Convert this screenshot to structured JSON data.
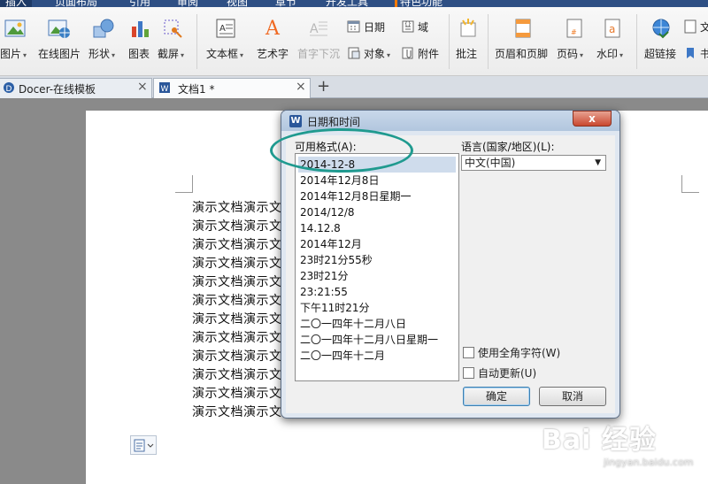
{
  "menu": {
    "tabs": [
      "插入",
      "页面布局",
      "引用",
      "审阅",
      "视图",
      "章节",
      "开发工具",
      "特色功能"
    ],
    "active": "插入"
  },
  "ribbon": {
    "items": {
      "picture": "图片",
      "online_picture": "在线图片",
      "shape": "形状",
      "chart": "图表",
      "screenshot": "截屏",
      "textbox": "文本框",
      "wordart": "艺术字",
      "dropcap": "首字下沉",
      "date": "日期",
      "object": "对象",
      "field": "域",
      "attachment": "附件",
      "comment": "批注",
      "header_footer": "页眉和页脚",
      "page_number": "页码",
      "watermark": "水印",
      "hyperlink": "超链接",
      "crossref_partial": "书",
      "text_partial": "文"
    }
  },
  "doc_tabs": [
    {
      "label": "Docer-在线模板",
      "close": "×"
    },
    {
      "label": "文档1 *",
      "close": "×"
    }
  ],
  "tab_add": "+",
  "document": {
    "line_text": "演示文档演示文档",
    "line_count": 12
  },
  "dialog": {
    "title": "日期和时间",
    "close": "x",
    "formats_label": "可用格式(A):",
    "formats": [
      "2014-12-8",
      "2014年12月8日",
      "2014年12月8日星期一",
      "2014/12/8",
      "14.12.8",
      "2014年12月",
      "23时21分55秒",
      "23时21分",
      "23:21:55",
      "下午11时21分",
      "二〇一四年十二月八日",
      "二〇一四年十二月八日星期一",
      "二〇一四年十二月"
    ],
    "selected_index": 0,
    "language_label": "语言(国家/地区)(L):",
    "language_value": "中文(中国)",
    "fullwidth_label": "使用全角字符(W)",
    "autoupdate_label": "自动更新(U)",
    "ok": "确定",
    "cancel": "取消"
  },
  "watermark": {
    "main": "Bai 经验",
    "sub": "jingyan.baidu.com"
  },
  "colors": {
    "highlight": "#1f9a8f",
    "menu_bg": "#2e4f84",
    "selected_row": "#cfdcec"
  }
}
